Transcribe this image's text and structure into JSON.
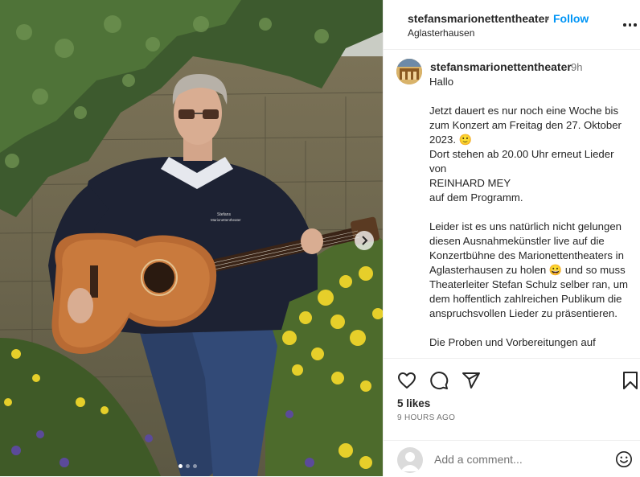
{
  "post": {
    "photo": {
      "sweater_print_line1": "Stefans",
      "sweater_print_line2": "Marionettentheater",
      "carousel_count": 3,
      "carousel_active": 1,
      "next_icon": "chevron-right-icon"
    },
    "header": {
      "username": "stefansmarionettentheater",
      "separator": "•",
      "follow_label": "Follow",
      "location": "Aglasterhausen",
      "more_icon": "more-horizontal-icon"
    },
    "caption": {
      "username": "stefansmarionettentheater",
      "time": "9h",
      "text": "Hallo\n\nJetzt dauert es nur noch eine Woche bis zum Konzert am Freitag den 27. Oktober 2023. 🙂\nDort stehen ab 20.00 Uhr erneut Lieder von\nREINHARD MEY\nauf dem Programm.\n\nLeider ist es uns natürlich nicht gelungen diesen Ausnahmekünstler live auf die Konzertbühne des Marionettentheaters in Aglasterhausen zu holen 😀 und so muss Theaterleiter Stefan Schulz selber ran, um dem hoffentlich zahlreichen Publikum die anspruchsvollen Lieder zu präsentieren.\n\nDie Proben und Vorbereitungen auf"
    },
    "actions": {
      "like_icon": "heart-icon",
      "comment_icon": "comment-icon",
      "share_icon": "send-icon",
      "save_icon": "bookmark-icon",
      "likes_text": "5 likes",
      "time_ago": "9 HOURS AGO"
    },
    "comment_box": {
      "placeholder": "Add a comment...",
      "emoji_icon": "smiley-icon"
    },
    "colors": {
      "accent": "#0095f6",
      "text": "#262626",
      "muted": "#737373",
      "divider": "#efefef"
    }
  }
}
